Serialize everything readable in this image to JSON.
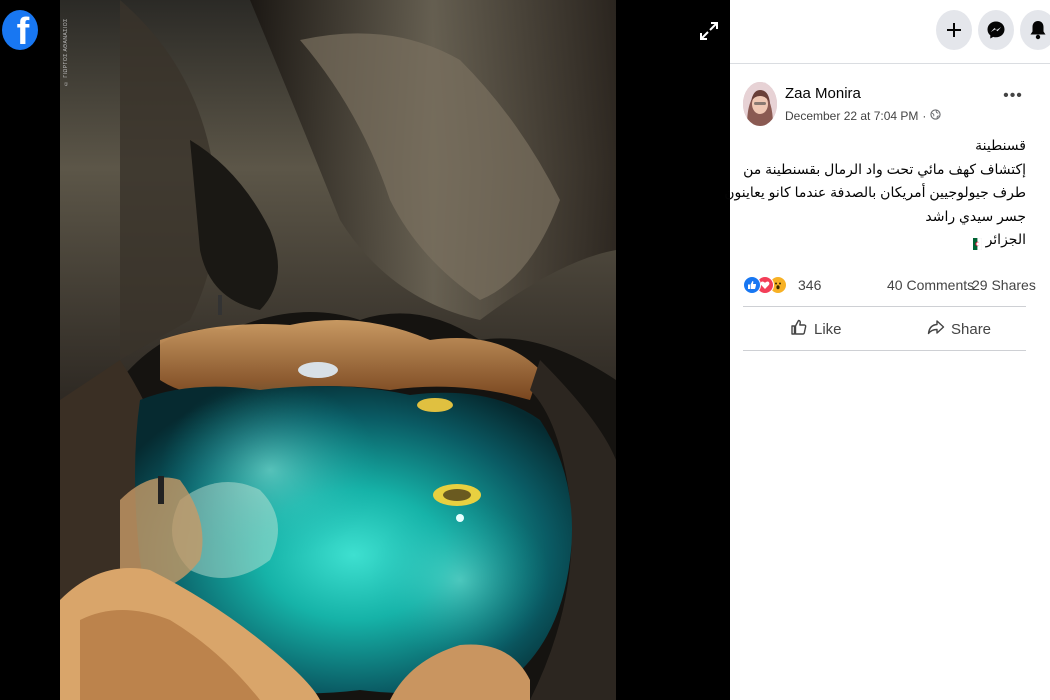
{
  "viewer": {
    "photo_credit": "© ΓΙΩΡΓΟΣ ΑΘΑΝΑΣΙΟΣ",
    "logo_letter": "f",
    "brand_color": "#1877f2"
  },
  "topbar": {
    "icons": [
      "plus-icon",
      "messenger-icon",
      "bell-icon"
    ]
  },
  "post": {
    "author": "Zaa Monira",
    "timestamp": "December 22 at 7:04 PM",
    "privacy_separator": "·",
    "privacy_icon": "globe-icon",
    "more_label": "•••",
    "text_lines": [
      "قسنطينة",
      "إكتشاف كهف مائي تحت واد الرمال بقسنطينة من",
      "طرف جيولوجيين أمريكان بالصدفة عندما كانو يعاينون",
      "جسر سيدي راشد",
      "الجزائر"
    ],
    "reactions": {
      "icons": [
        "like-icon",
        "love-icon",
        "wow-icon"
      ],
      "count": "346",
      "comments": "40 Comments",
      "shares": "29 Shares"
    },
    "actions": {
      "like": "Like",
      "share": "Share"
    }
  }
}
